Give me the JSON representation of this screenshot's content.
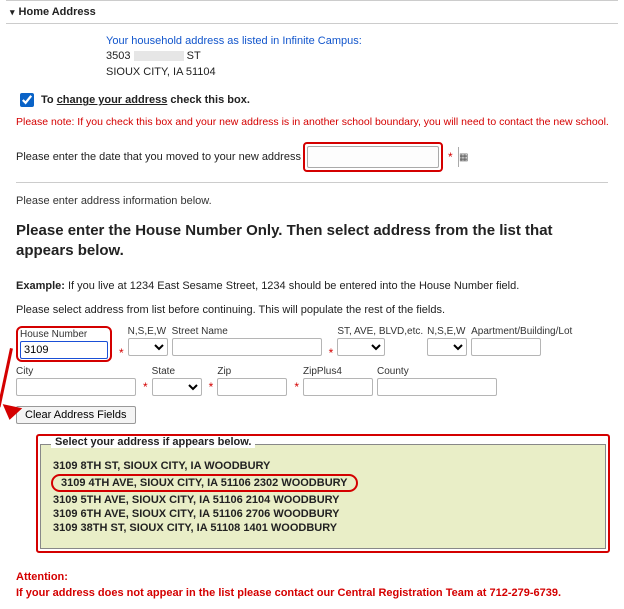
{
  "section": {
    "title": "Home Address"
  },
  "household": {
    "intro": "Your household address as listed in Infinite Campus:",
    "line1_a": "3503",
    "line1_b": "ST",
    "line2": "SIOUX CITY, IA 51104"
  },
  "change_checkbox": {
    "prefix": "To ",
    "underlined": "change your address",
    "suffix": " check this box.",
    "checked": true
  },
  "red_note": "Please note: If you check this box and your new address is in another school boundary, you will need to contact the new school.",
  "date_row": {
    "label": "Please enter the date that you moved to your new address"
  },
  "addr_info_label": "Please enter address information below.",
  "big_instruction": "Please enter the House Number Only. Then select address from the list that appears below.",
  "example": {
    "label": "Example:",
    "text": " If you live at 1234 East Sesame Street, 1234 should be entered into the House Number field."
  },
  "pre_select_text": "Please select address from list before continuing. This will populate the rest of the fields.",
  "fields": {
    "house_number": {
      "label": "House Number",
      "value": "3109"
    },
    "nsew1": {
      "label": "N,S,E,W"
    },
    "street_name": {
      "label": "Street Name"
    },
    "st_ave": {
      "label": "ST, AVE, BLVD,etc."
    },
    "nsew2": {
      "label": "N,S,E,W"
    },
    "apt": {
      "label": "Apartment/Building/Lot"
    },
    "city": {
      "label": "City"
    },
    "state": {
      "label": "State"
    },
    "zip": {
      "label": "Zip"
    },
    "zip4": {
      "label": "ZipPlus4"
    },
    "county": {
      "label": "County"
    }
  },
  "clear_button": "Clear Address Fields",
  "results": {
    "legend": "Select your address if appears below.",
    "items": [
      "3109 8TH ST, SIOUX CITY, IA WOODBURY",
      "3109 4TH AVE, SIOUX CITY, IA 51106 2302 WOODBURY",
      "3109 5TH AVE, SIOUX CITY, IA 51106 2104 WOODBURY",
      "3109 6TH AVE, SIOUX CITY, IA 51106 2706 WOODBURY",
      "3109 38TH ST, SIOUX CITY, IA 51108 1401 WOODBURY"
    ],
    "selected_index": 1
  },
  "attention": {
    "title": "Attention:",
    "body": "If your address does not appear in the list please contact our Central Registration Team at 712-279-6739."
  }
}
